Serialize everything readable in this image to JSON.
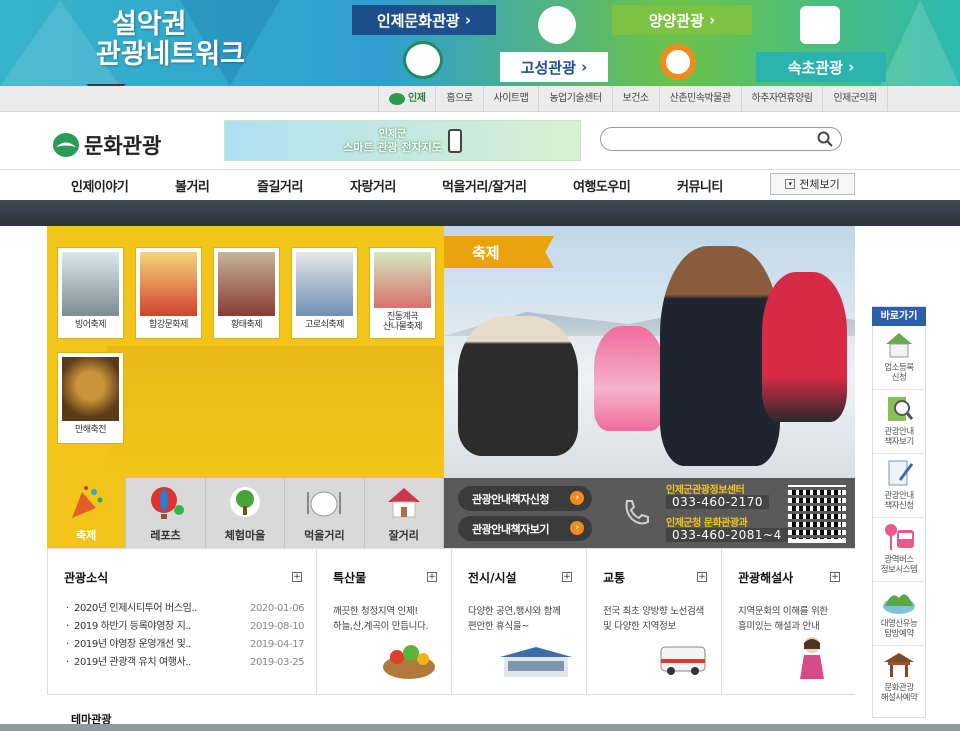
{
  "banner": {
    "title_line1": "설악권",
    "title_line2": "관광네트워크",
    "cards": [
      "인제문화관광",
      "고성관광",
      "양양관광",
      "속초관광"
    ]
  },
  "utility": {
    "logo_text": "인제",
    "links": [
      "홈으로",
      "사이트맵",
      "농업기술센터",
      "보건소",
      "산촌민속박물관",
      "하추자연휴양림",
      "인제군의회"
    ]
  },
  "header": {
    "logo": "문화관광",
    "promo_line1": "인제군",
    "promo_line2": "스마트 관광 전자지도"
  },
  "gnb": {
    "items": [
      "인제이야기",
      "볼거리",
      "즐길거리",
      "자랑거리",
      "먹을거리/잘거리",
      "여행도우미",
      "커뮤니티"
    ],
    "all_label": "전체보기"
  },
  "festival": {
    "ribbon": "축제",
    "thumbs": [
      "빙어축제",
      "합강문화제",
      "황태축제",
      "고로쇠축제",
      "진동계곡\n산나물축제",
      "만해축전"
    ]
  },
  "tabs": [
    "축제",
    "레포츠",
    "체험마을",
    "먹을거리",
    "잘거리"
  ],
  "guide": {
    "btn1": "관광안내책자신청",
    "btn2": "관광안내책자보기",
    "center1": "인제군관광정보센터",
    "phone1": "033-460-2170",
    "center2": "인제군청 문화관광과",
    "phone2": "033-460-2081~4"
  },
  "quick": {
    "title": "바로가기",
    "items": [
      "업소등록\n신청",
      "관광안내\n책자보기",
      "관광안내\n책자신청",
      "광역버스\n정보시스템",
      "대영산유능\n탐방예약",
      "문화관광\n해설사예약"
    ]
  },
  "news": {
    "title": "관광소식",
    "rows": [
      {
        "t": "2020년 인제시티투어 버스임..",
        "d": "2020-01-06"
      },
      {
        "t": "2019 하반기 등록야영장 지..",
        "d": "2019-08-10"
      },
      {
        "t": "2019년 야영장 운영개선 및..",
        "d": "2019-04-17"
      },
      {
        "t": "2019년 관광객 유치 여행사..",
        "d": "2019-03-25"
      }
    ]
  },
  "boxes": [
    {
      "title": "특산물",
      "body": "깨끗한 청정지역 인제!\n하늘,산,계곡이 만듭니다."
    },
    {
      "title": "전시/시설",
      "body": "다양한 공연,행사와 함께\n편안한 휴식을~"
    },
    {
      "title": "교통",
      "body": "전국 최초 양방향 노선검색\n및 다양한 지역정보"
    },
    {
      "title": "관광해설사",
      "body": "지역문화의 이해를 위한\n흥미있는 해설과 안내"
    }
  ],
  "bottom_title": "테마관광",
  "colors": {
    "accent_yellow": "#f3c51a",
    "nav_blue": "#2d5ea8",
    "dark_bar": "#323c45"
  }
}
